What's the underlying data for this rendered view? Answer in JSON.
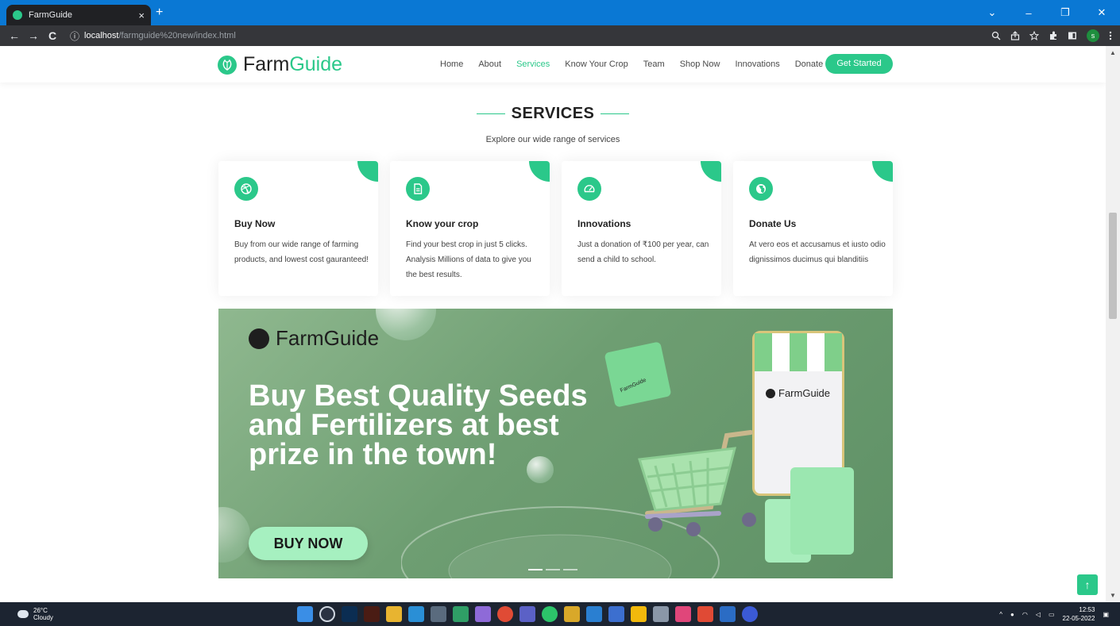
{
  "browser": {
    "tab_title": "FarmGuide",
    "tab_close": "×",
    "new_tab": "+",
    "url_host": "localhost",
    "url_path": "/farmguide%20new/index.html",
    "nav_back": "←",
    "nav_forward": "→",
    "nav_reload": "C",
    "info_icon": "ⓘ",
    "win_chevron": "⌄",
    "win_minimize": "–",
    "win_restore": "❐",
    "win_close": "✕",
    "profile_initial": "s"
  },
  "site": {
    "logo_word1": "Farm",
    "logo_word2": "Guide",
    "nav": [
      {
        "label": "Home"
      },
      {
        "label": "About"
      },
      {
        "label": "Services"
      },
      {
        "label": "Know Your Crop"
      },
      {
        "label": "Team"
      },
      {
        "label": "Shop Now"
      },
      {
        "label": "Innovations"
      },
      {
        "label": "Donate"
      }
    ],
    "active_nav": "Services",
    "cta_label": "Get Started",
    "accent": "#2bc88a"
  },
  "services": {
    "title": "SERVICES",
    "subtitle": "Explore our wide range of services",
    "cards": [
      {
        "icon": "dribbble-icon",
        "title": "Buy Now",
        "text": "Buy from our wide range of farming products, and lowest cost gauranteed!"
      },
      {
        "icon": "document-icon",
        "title": "Know your crop",
        "text": "Find your best crop in just 5 clicks. Analysis Millions of data to give you the best results."
      },
      {
        "icon": "speedometer-icon",
        "title": "Innovations",
        "text": "Just a donation of ₹100 per year, can send a child to school."
      },
      {
        "icon": "globe-icon",
        "title": "Donate Us",
        "text": "At vero eos et accusamus et iusto odio dignissimos ducimus qui blanditiis"
      }
    ]
  },
  "banner": {
    "brand": "FarmGuide",
    "headline": "Buy Best Quality Seeds and Fertilizers at best prize in the town!",
    "button": "BUY NOW",
    "phone_brand": "FarmGuide",
    "bag_brand": "FarmGuide",
    "slides": 3,
    "active_slide": 1
  },
  "back_to_top": "↑",
  "taskbar": {
    "temperature": "26°C",
    "condition": "Cloudy",
    "time": "12:53",
    "date": "22-05-2022"
  }
}
